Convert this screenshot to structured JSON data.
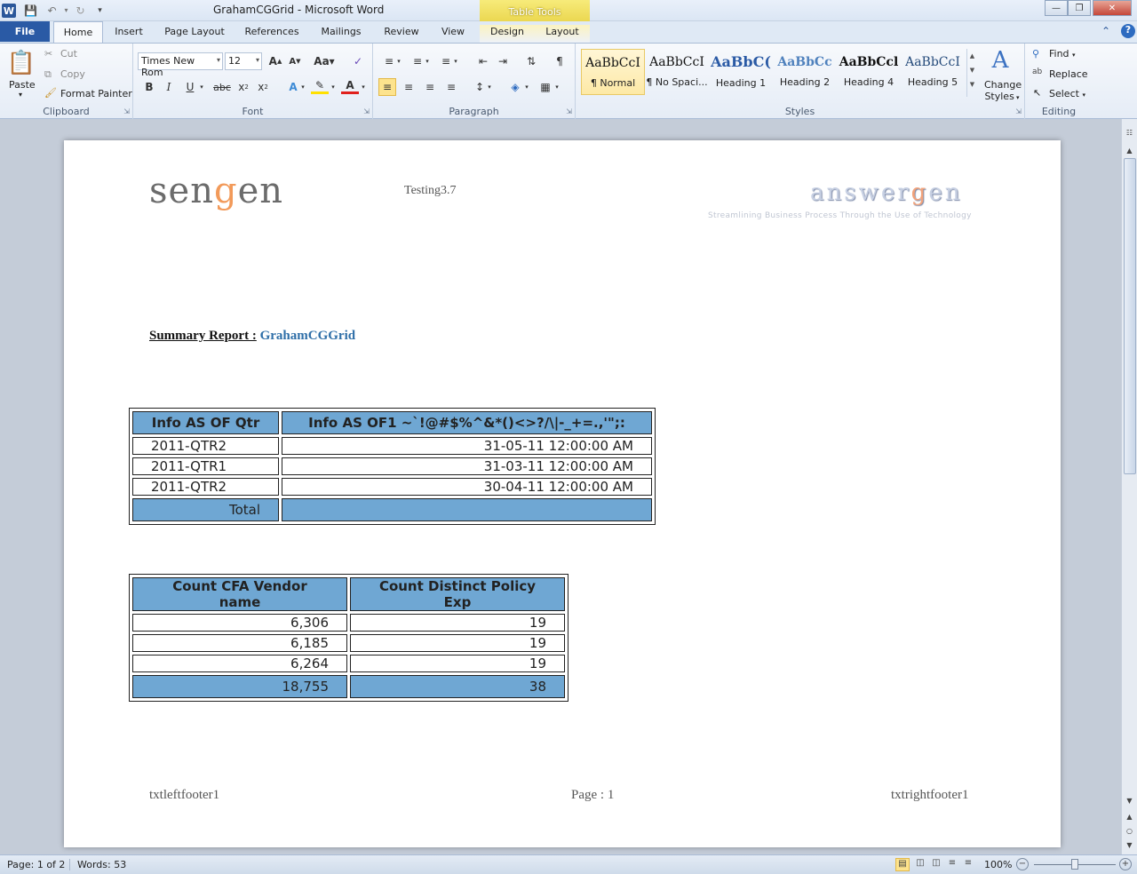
{
  "window": {
    "title": "GrahamCGGrid  -  Microsoft Word",
    "contextual_tab_group": "Table Tools"
  },
  "tabs": [
    "File",
    "Home",
    "Insert",
    "Page Layout",
    "References",
    "Mailings",
    "Review",
    "View",
    "Design",
    "Layout"
  ],
  "ribbon": {
    "clipboard": {
      "paste": "Paste",
      "cut": "Cut",
      "copy": "Copy",
      "format_painter": "Format Painter",
      "label": "Clipboard"
    },
    "font": {
      "font_name": "Times New Rom",
      "font_size": "12",
      "label": "Font"
    },
    "paragraph": {
      "label": "Paragraph"
    },
    "styles": {
      "label": "Styles",
      "items": [
        {
          "sample": "AaBbCcI",
          "name": "¶ Normal"
        },
        {
          "sample": "AaBbCcI",
          "name": "¶ No Spaci..."
        },
        {
          "sample": "AaBbC(",
          "name": "Heading 1"
        },
        {
          "sample": "AaBbCc",
          "name": "Heading 2"
        },
        {
          "sample": "AaBbCcl",
          "name": "Heading 4"
        },
        {
          "sample": "AaBbCcI",
          "name": "Heading 5"
        }
      ],
      "change_styles": [
        "Change",
        "Styles"
      ]
    },
    "editing": {
      "find": "Find",
      "replace": "Replace",
      "select": "Select",
      "label": "Editing"
    }
  },
  "document": {
    "header": {
      "logo_left": "sengen",
      "center_text": "Testing3.7",
      "logo_right": "answergen",
      "tagline": "Streamlining Business Process Through the Use of Technology"
    },
    "summary": {
      "label": "Summary Report :",
      "value": "GrahamCGGrid"
    },
    "table1": {
      "headers": [
        "Info AS OF Qtr",
        "Info AS OF1 ~`!@#$%^&*()<>?/\\|-_+=.,'\";:"
      ],
      "rows": [
        [
          "2011-QTR2",
          "31-05-11 12:00:00 AM"
        ],
        [
          "2011-QTR1",
          "31-03-11 12:00:00 AM"
        ],
        [
          "2011-QTR2",
          "30-04-11 12:00:00 AM"
        ]
      ],
      "total": [
        "Total",
        ""
      ]
    },
    "table2": {
      "headers": [
        "Count CFA Vendor name",
        "Count Distinct Policy Exp"
      ],
      "rows": [
        [
          "6,306",
          "19"
        ],
        [
          "6,185",
          "19"
        ],
        [
          "6,264",
          "19"
        ]
      ],
      "total": [
        "18,755",
        "38"
      ]
    },
    "footer": {
      "left": "txtleftfooter1",
      "center": "Page : 1",
      "right": "txtrightfooter1"
    }
  },
  "statusbar": {
    "page": "Page: 1 of 2",
    "words": "Words: 53",
    "zoom": "100%"
  },
  "colors": {
    "table_header": "#6fa7d3",
    "file_tab": "#2a5aa5",
    "summary_value": "#2f6fa8",
    "table_tools": "#e9d44a"
  }
}
